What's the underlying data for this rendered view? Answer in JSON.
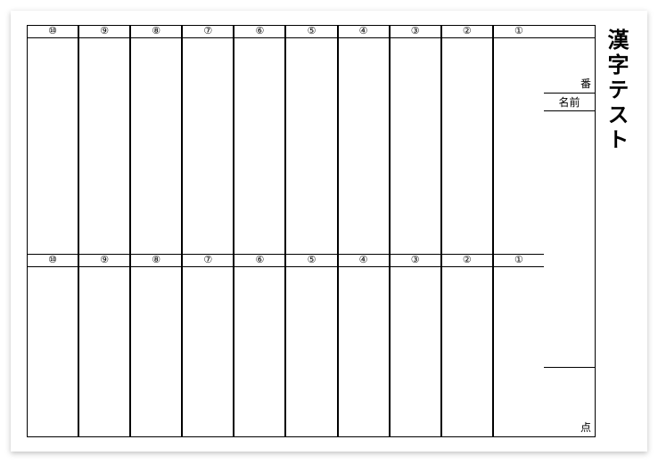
{
  "title": "漢字テスト",
  "labels": {
    "ban": "番",
    "name": "名前",
    "ten": "点"
  },
  "columns": [
    "⑩",
    "⑨",
    "⑧",
    "⑦",
    "⑥",
    "⑤",
    "④",
    "③",
    "②",
    "①"
  ]
}
